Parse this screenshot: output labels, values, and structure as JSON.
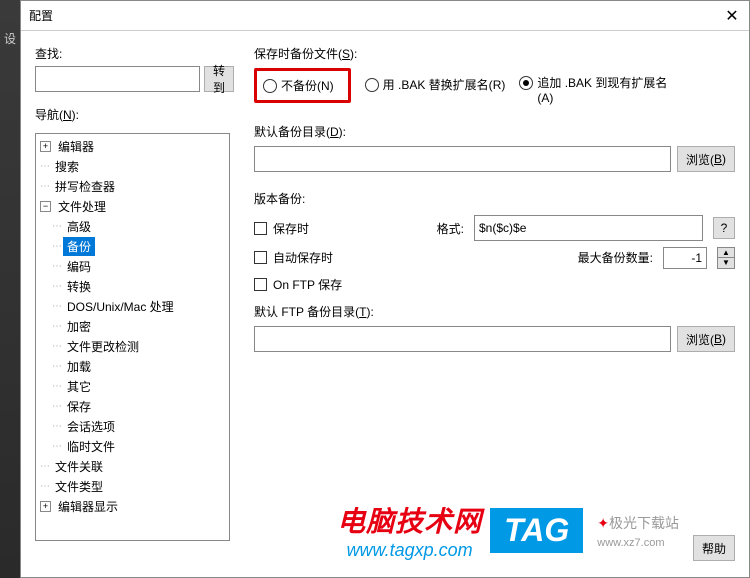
{
  "title": "配置",
  "search_label": "查找:",
  "go_label": "转到",
  "nav_label": "导航(N):",
  "tree": {
    "editor": "编辑器",
    "search": "搜索",
    "spell": "拼写检查器",
    "file_handling": "文件处理",
    "advanced": "高级",
    "backup": "备份",
    "encoding": "编码",
    "convert": "转换",
    "dosunix": "DOS/Unix/Mac 处理",
    "encrypt": "加密",
    "change_detect": "文件更改检测",
    "load": "加载",
    "misc": "其它",
    "save": "保存",
    "session": "会话选项",
    "temp": "临时文件",
    "file_assoc": "文件关联",
    "file_type": "文件类型",
    "editor_disp": "编辑器显示"
  },
  "save_backup_label": "保存时备份文件(S):",
  "radio": {
    "no_backup": "不备份(N)",
    "bak_ext": "用 .BAK 替换扩展名(R)",
    "append_bak": "追加 .BAK 到现有扩展名(A)",
    "append_bak_line": "追加 .BAK 到现有扩展名",
    "append_bak_u": "(A)"
  },
  "default_backup_dir": "默认备份目录(D):",
  "browse": "浏览(B)",
  "version_backup": "版本备份:",
  "cb_on_save": "保存时",
  "cb_on_autosave": "自动保存时",
  "cb_on_ftp": "On FTP 保存",
  "format_label": "格式:",
  "format_value": "$n($c)$e",
  "max_backup_label": "最大备份数量:",
  "max_backup_value": "-1",
  "default_ftp_dir": "默认 FTP 备份目录(T):",
  "help_label": "帮助",
  "watermark": {
    "title": "电脑技术网",
    "url": "www.tagxp.com",
    "tag": "TAG",
    "jg": "极光下载站",
    "jg_url": "www.xz7.com"
  }
}
